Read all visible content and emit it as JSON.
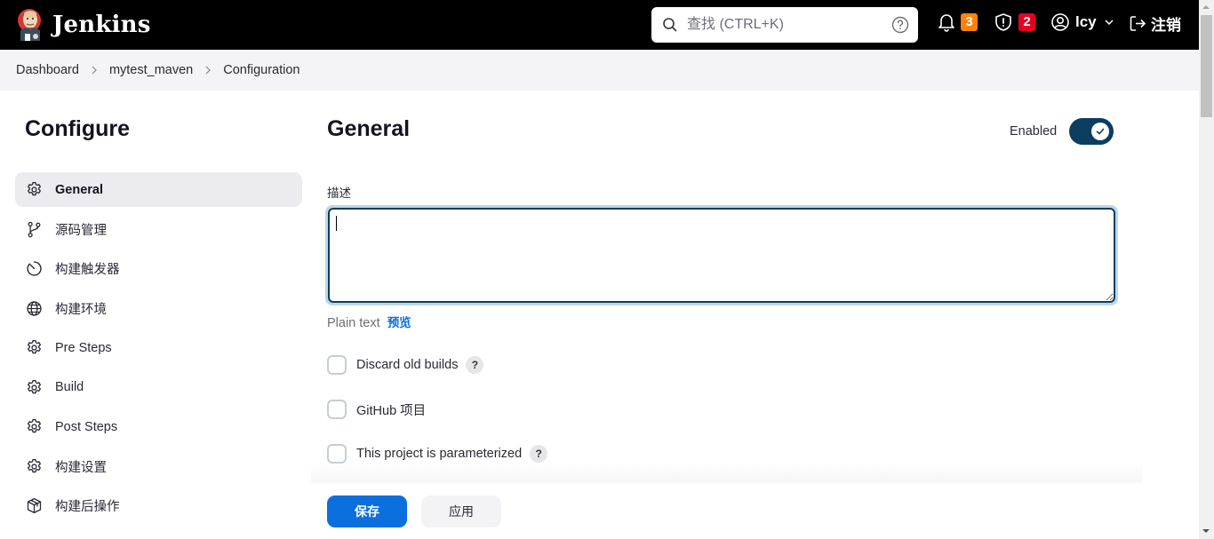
{
  "header": {
    "app_name": "Jenkins",
    "search": {
      "placeholder": "查找 (CTRL+K)",
      "value": ""
    },
    "notifications_count": "3",
    "security_count": "2",
    "user_name": "lcy",
    "logout_label": "注销",
    "colors": {
      "notifications_badge": "#fe820a",
      "security_badge": "#e6001f"
    }
  },
  "breadcrumb": [
    {
      "label": "Dashboard"
    },
    {
      "label": "mytest_maven"
    },
    {
      "label": "Configuration"
    }
  ],
  "sidebar": {
    "title": "Configure",
    "items": [
      {
        "label": "General",
        "icon": "gear-icon",
        "active": true
      },
      {
        "label": "源码管理",
        "icon": "git-branch-icon",
        "active": false
      },
      {
        "label": "构建触发器",
        "icon": "timer-icon",
        "active": false
      },
      {
        "label": "构建环境",
        "icon": "globe-icon",
        "active": false
      },
      {
        "label": "Pre Steps",
        "icon": "gear-icon",
        "active": false
      },
      {
        "label": "Build",
        "icon": "gear-icon",
        "active": false
      },
      {
        "label": "Post Steps",
        "icon": "gear-icon",
        "active": false
      },
      {
        "label": "构建设置",
        "icon": "gear-icon",
        "active": false
      },
      {
        "label": "构建后操作",
        "icon": "package-icon",
        "active": false
      }
    ]
  },
  "main": {
    "title": "General",
    "enabled_label": "Enabled",
    "enabled": true,
    "description": {
      "label": "描述",
      "value": ""
    },
    "format_label": "Plain text",
    "preview_label": "预览",
    "options": [
      {
        "label": "Discard old builds",
        "checked": false,
        "has_help": true
      },
      {
        "label": "GitHub 项目",
        "checked": false,
        "has_help": false
      },
      {
        "label": "This project is parameterized",
        "checked": false,
        "has_help": true
      }
    ],
    "help_symbol": "?"
  },
  "actions": {
    "save_label": "保存",
    "apply_label": "应用"
  },
  "colors": {
    "accent": "#0b6fde",
    "toggle": "#0b3d5e"
  }
}
